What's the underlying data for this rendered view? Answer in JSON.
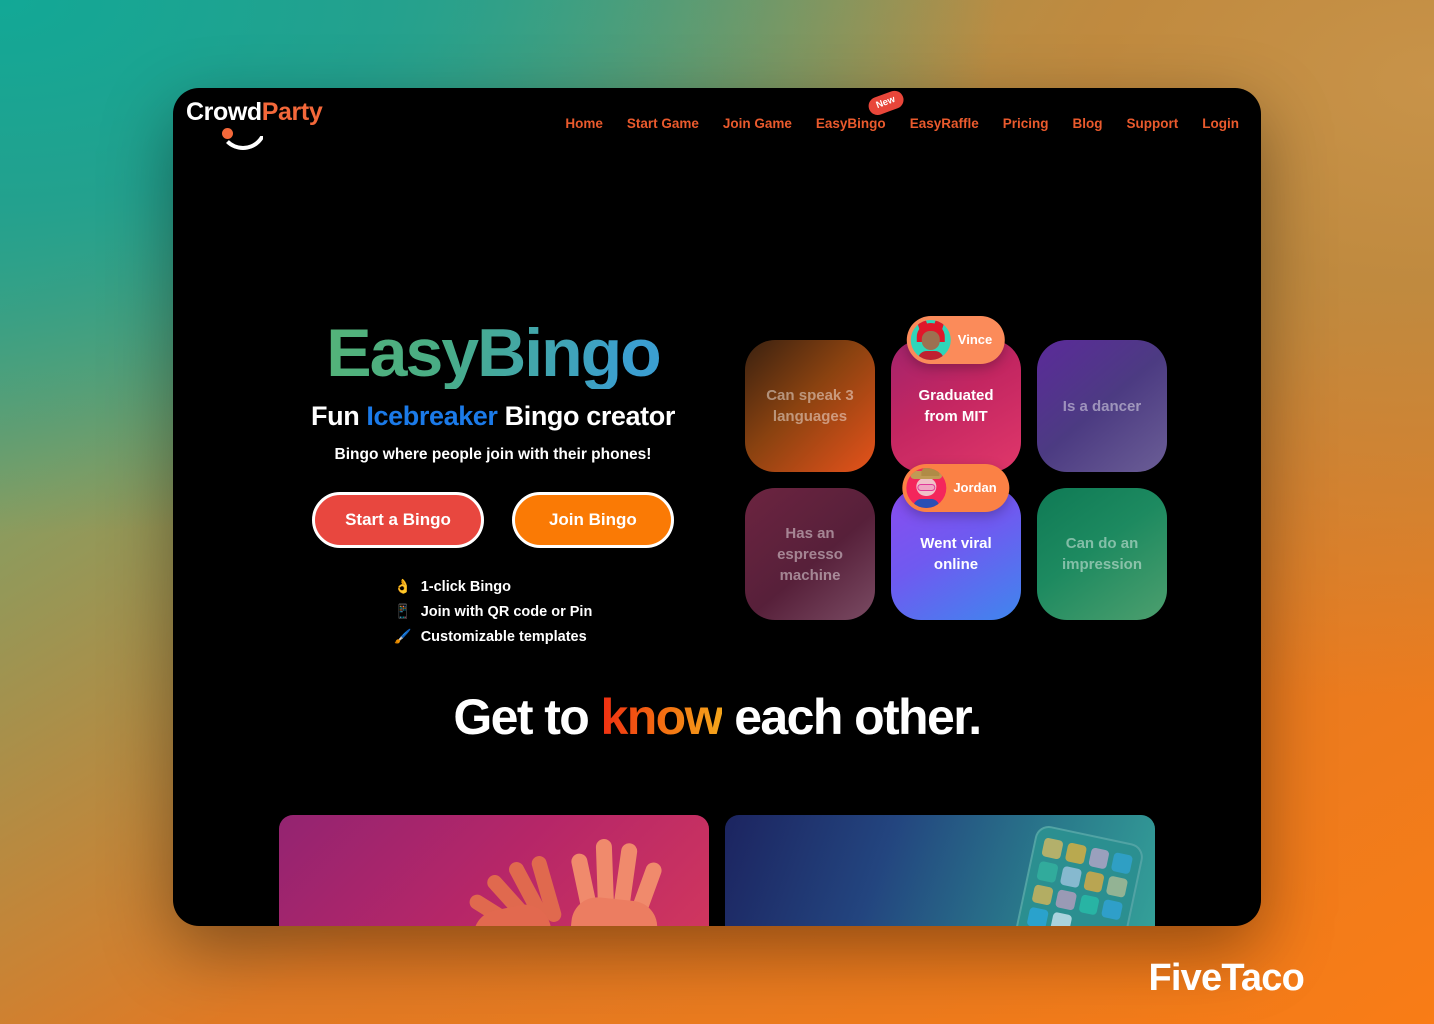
{
  "brand": {
    "logo_crowd": "Crowd",
    "logo_party": "Party",
    "accent_orange": "#f4683a",
    "accent_red": "#e8473f"
  },
  "nav": {
    "items": [
      {
        "label": "Home"
      },
      {
        "label": "Start Game"
      },
      {
        "label": "Join Game"
      },
      {
        "label": "EasyBingo",
        "badge": "New"
      },
      {
        "label": "EasyRaffle"
      },
      {
        "label": "Pricing"
      },
      {
        "label": "Blog"
      },
      {
        "label": "Support"
      },
      {
        "label": "Login"
      }
    ]
  },
  "hero": {
    "title": "EasyBingo",
    "subtitle_pre": "Fun ",
    "subtitle_highlight": "Icebreaker",
    "subtitle_post": " Bingo creator",
    "tagline": "Bingo where people join with their phones!",
    "cta_primary": "Start a Bingo",
    "cta_secondary": "Join Bingo",
    "features": [
      {
        "emoji": "👌",
        "label": "1-click Bingo"
      },
      {
        "emoji": "📱",
        "label": "Join with QR code or Pin"
      },
      {
        "emoji": "🖌️",
        "label": "Customizable templates"
      }
    ]
  },
  "bingo_cards": [
    {
      "text": "Can speak 3 languages",
      "marked": false,
      "player": null
    },
    {
      "text": "Graduated from MIT",
      "marked": true,
      "player": "Vince"
    },
    {
      "text": "Is a dancer",
      "marked": false,
      "player": null
    },
    {
      "text": "Has an espresso machine",
      "marked": false,
      "player": null
    },
    {
      "text": "Went viral online",
      "marked": true,
      "player": "Jordan"
    },
    {
      "text": "Can do an impression",
      "marked": false,
      "player": null
    }
  ],
  "section_know": {
    "heading_pre": "Get to ",
    "heading_highlight": "know",
    "heading_post": " each other."
  },
  "watermark": {
    "label": "FiveTaco"
  }
}
